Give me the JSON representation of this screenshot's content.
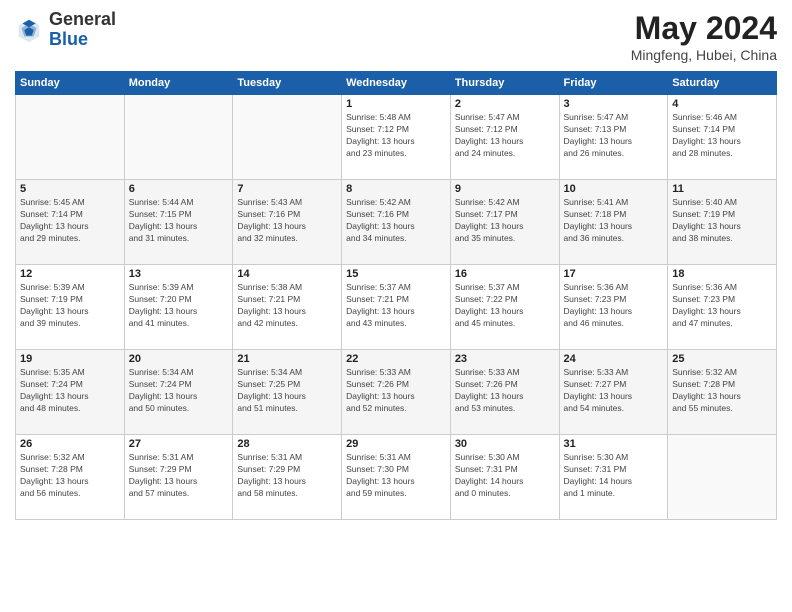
{
  "logo": {
    "general": "General",
    "blue": "Blue"
  },
  "header": {
    "month_year": "May 2024",
    "location": "Mingfeng, Hubei, China"
  },
  "days_of_week": [
    "Sunday",
    "Monday",
    "Tuesday",
    "Wednesday",
    "Thursday",
    "Friday",
    "Saturday"
  ],
  "weeks": [
    [
      {
        "day": "",
        "info": ""
      },
      {
        "day": "",
        "info": ""
      },
      {
        "day": "",
        "info": ""
      },
      {
        "day": "1",
        "info": "Sunrise: 5:48 AM\nSunset: 7:12 PM\nDaylight: 13 hours\nand 23 minutes."
      },
      {
        "day": "2",
        "info": "Sunrise: 5:47 AM\nSunset: 7:12 PM\nDaylight: 13 hours\nand 24 minutes."
      },
      {
        "day": "3",
        "info": "Sunrise: 5:47 AM\nSunset: 7:13 PM\nDaylight: 13 hours\nand 26 minutes."
      },
      {
        "day": "4",
        "info": "Sunrise: 5:46 AM\nSunset: 7:14 PM\nDaylight: 13 hours\nand 28 minutes."
      }
    ],
    [
      {
        "day": "5",
        "info": "Sunrise: 5:45 AM\nSunset: 7:14 PM\nDaylight: 13 hours\nand 29 minutes."
      },
      {
        "day": "6",
        "info": "Sunrise: 5:44 AM\nSunset: 7:15 PM\nDaylight: 13 hours\nand 31 minutes."
      },
      {
        "day": "7",
        "info": "Sunrise: 5:43 AM\nSunset: 7:16 PM\nDaylight: 13 hours\nand 32 minutes."
      },
      {
        "day": "8",
        "info": "Sunrise: 5:42 AM\nSunset: 7:16 PM\nDaylight: 13 hours\nand 34 minutes."
      },
      {
        "day": "9",
        "info": "Sunrise: 5:42 AM\nSunset: 7:17 PM\nDaylight: 13 hours\nand 35 minutes."
      },
      {
        "day": "10",
        "info": "Sunrise: 5:41 AM\nSunset: 7:18 PM\nDaylight: 13 hours\nand 36 minutes."
      },
      {
        "day": "11",
        "info": "Sunrise: 5:40 AM\nSunset: 7:19 PM\nDaylight: 13 hours\nand 38 minutes."
      }
    ],
    [
      {
        "day": "12",
        "info": "Sunrise: 5:39 AM\nSunset: 7:19 PM\nDaylight: 13 hours\nand 39 minutes."
      },
      {
        "day": "13",
        "info": "Sunrise: 5:39 AM\nSunset: 7:20 PM\nDaylight: 13 hours\nand 41 minutes."
      },
      {
        "day": "14",
        "info": "Sunrise: 5:38 AM\nSunset: 7:21 PM\nDaylight: 13 hours\nand 42 minutes."
      },
      {
        "day": "15",
        "info": "Sunrise: 5:37 AM\nSunset: 7:21 PM\nDaylight: 13 hours\nand 43 minutes."
      },
      {
        "day": "16",
        "info": "Sunrise: 5:37 AM\nSunset: 7:22 PM\nDaylight: 13 hours\nand 45 minutes."
      },
      {
        "day": "17",
        "info": "Sunrise: 5:36 AM\nSunset: 7:23 PM\nDaylight: 13 hours\nand 46 minutes."
      },
      {
        "day": "18",
        "info": "Sunrise: 5:36 AM\nSunset: 7:23 PM\nDaylight: 13 hours\nand 47 minutes."
      }
    ],
    [
      {
        "day": "19",
        "info": "Sunrise: 5:35 AM\nSunset: 7:24 PM\nDaylight: 13 hours\nand 48 minutes."
      },
      {
        "day": "20",
        "info": "Sunrise: 5:34 AM\nSunset: 7:24 PM\nDaylight: 13 hours\nand 50 minutes."
      },
      {
        "day": "21",
        "info": "Sunrise: 5:34 AM\nSunset: 7:25 PM\nDaylight: 13 hours\nand 51 minutes."
      },
      {
        "day": "22",
        "info": "Sunrise: 5:33 AM\nSunset: 7:26 PM\nDaylight: 13 hours\nand 52 minutes."
      },
      {
        "day": "23",
        "info": "Sunrise: 5:33 AM\nSunset: 7:26 PM\nDaylight: 13 hours\nand 53 minutes."
      },
      {
        "day": "24",
        "info": "Sunrise: 5:33 AM\nSunset: 7:27 PM\nDaylight: 13 hours\nand 54 minutes."
      },
      {
        "day": "25",
        "info": "Sunrise: 5:32 AM\nSunset: 7:28 PM\nDaylight: 13 hours\nand 55 minutes."
      }
    ],
    [
      {
        "day": "26",
        "info": "Sunrise: 5:32 AM\nSunset: 7:28 PM\nDaylight: 13 hours\nand 56 minutes."
      },
      {
        "day": "27",
        "info": "Sunrise: 5:31 AM\nSunset: 7:29 PM\nDaylight: 13 hours\nand 57 minutes."
      },
      {
        "day": "28",
        "info": "Sunrise: 5:31 AM\nSunset: 7:29 PM\nDaylight: 13 hours\nand 58 minutes."
      },
      {
        "day": "29",
        "info": "Sunrise: 5:31 AM\nSunset: 7:30 PM\nDaylight: 13 hours\nand 59 minutes."
      },
      {
        "day": "30",
        "info": "Sunrise: 5:30 AM\nSunset: 7:31 PM\nDaylight: 14 hours\nand 0 minutes."
      },
      {
        "day": "31",
        "info": "Sunrise: 5:30 AM\nSunset: 7:31 PM\nDaylight: 14 hours\nand 1 minute."
      },
      {
        "day": "",
        "info": ""
      }
    ]
  ]
}
